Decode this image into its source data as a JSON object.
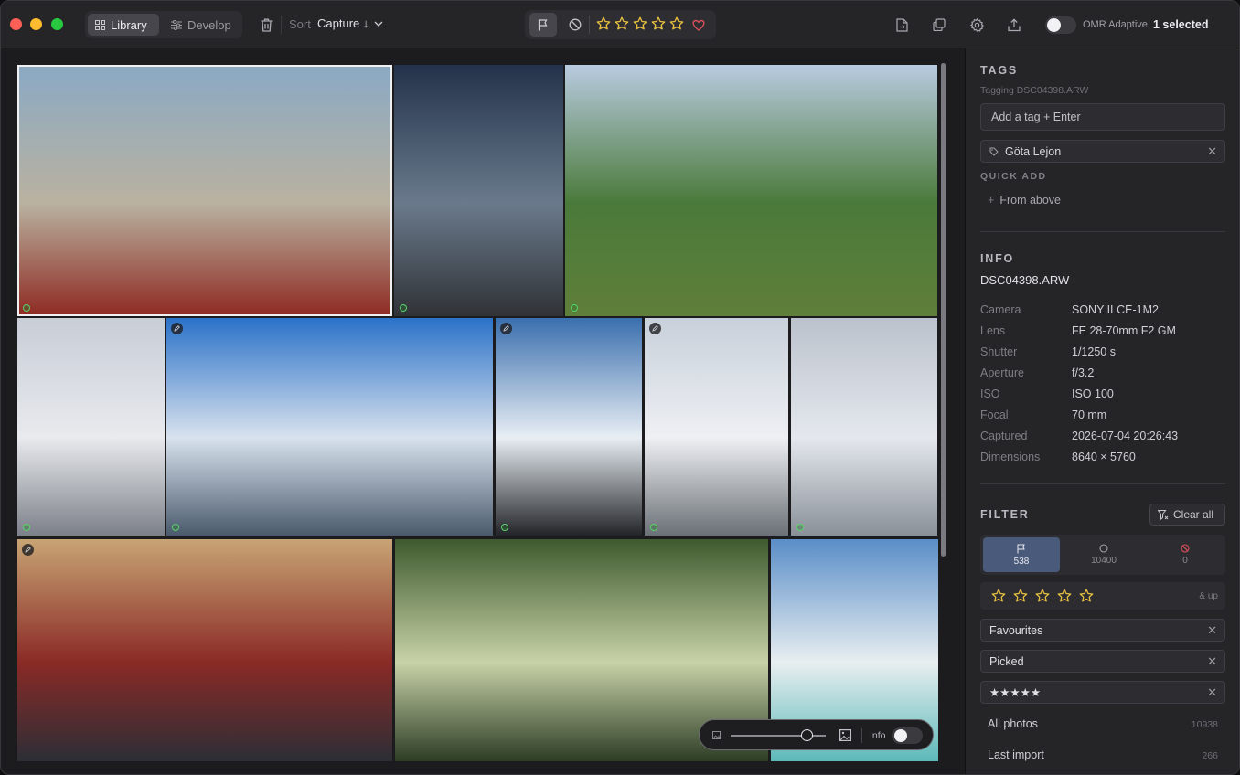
{
  "toolbar": {
    "library_label": "Library",
    "develop_label": "Develop",
    "sort_label": "Sort",
    "sort_value": "Capture ↓",
    "omr_label": "OMR Adaptive",
    "selection_status": "1 selected",
    "rating_stars": 5,
    "toggle_on": false
  },
  "grid": {
    "tiles": [
      {
        "name": "fire-truck",
        "colors": [
          "#8aa9c4",
          "#b9b2a0",
          "#8e2a22"
        ],
        "picked": true,
        "edited": false,
        "selected": true
      },
      {
        "name": "space-shuttle",
        "colors": [
          "#23324a",
          "#6a7a8c",
          "#303236"
        ],
        "picked": true,
        "edited": false,
        "selected": false
      },
      {
        "name": "baseball-field",
        "colors": [
          "#b9cbe0",
          "#4a7a3a",
          "#5f7f3a"
        ],
        "picked": true,
        "edited": false,
        "selected": false
      },
      {
        "name": "ski-lift",
        "colors": [
          "#c8cdd6",
          "#e8eaee",
          "#7c8088"
        ],
        "picked": true,
        "edited": false,
        "selected": false
      },
      {
        "name": "snowy-mountains",
        "colors": [
          "#2a72c8",
          "#d8e2ee",
          "#4a5a6c"
        ],
        "picked": true,
        "edited": true,
        "selected": false
      },
      {
        "name": "cable-car-station",
        "colors": [
          "#3a6fae",
          "#e8eef4",
          "#222428"
        ],
        "picked": true,
        "edited": true,
        "selected": false
      },
      {
        "name": "gondola",
        "colors": [
          "#c8d0da",
          "#eef0f4",
          "#6a7076"
        ],
        "picked": true,
        "edited": true,
        "selected": false
      },
      {
        "name": "cable-car-distant",
        "colors": [
          "#bcc2cc",
          "#e4e8ee",
          "#8a9098"
        ],
        "picked": true,
        "edited": false,
        "selected": false
      },
      {
        "name": "vintage-skis",
        "colors": [
          "#c8a474",
          "#8a2a26",
          "#2a2e36"
        ],
        "picked": false,
        "edited": true,
        "selected": false
      },
      {
        "name": "tropical-path",
        "colors": [
          "#3e5a2e",
          "#c8d2a8",
          "#2a3a22"
        ],
        "picked": false,
        "edited": false,
        "selected": false
      },
      {
        "name": "palm-beach",
        "colors": [
          "#5a8ec8",
          "#e8eef0",
          "#5ab8b8"
        ],
        "picked": false,
        "edited": false,
        "selected": false
      }
    ]
  },
  "zoom": {
    "info_label": "Info",
    "level": 0.8,
    "info_on": true
  },
  "sidebar": {
    "tags": {
      "title": "TAGS",
      "subtitle": "Tagging DSC04398.ARW",
      "placeholder": "Add a tag + Enter",
      "chips": [
        "Göta Lejon"
      ],
      "quick_add_title": "QUICK ADD",
      "quick_add_item": "From above"
    },
    "info": {
      "title": "INFO",
      "filename": "DSC04398.ARW",
      "rows": [
        {
          "k": "Camera",
          "v": "SONY ILCE-1M2"
        },
        {
          "k": "Lens",
          "v": "FE 28-70mm F2 GM"
        },
        {
          "k": "Shutter",
          "v": "1/1250 s"
        },
        {
          "k": "Aperture",
          "v": "f/3.2"
        },
        {
          "k": "ISO",
          "v": "ISO 100"
        },
        {
          "k": "Focal",
          "v": "70 mm"
        },
        {
          "k": "Captured",
          "v": "2026-07-04 20:26:43"
        },
        {
          "k": "Dimensions",
          "v": "8640 × 5760"
        }
      ]
    },
    "filter": {
      "title": "FILTER",
      "clear_all": "Clear all",
      "picked_count": "538",
      "unflagged_count": "10400",
      "rejected_count": "0",
      "and_up": "& up",
      "active_filters": [
        "Favourites",
        "Picked",
        "★★★★★"
      ],
      "lists": [
        {
          "label": "All photos",
          "count": "10938"
        },
        {
          "label": "Last import",
          "count": "266"
        }
      ]
    }
  },
  "colors": {
    "accent": "#4a5a7a",
    "pick_green": "#5bd16a",
    "heart": "#e0505a",
    "star": "#e8c040"
  }
}
